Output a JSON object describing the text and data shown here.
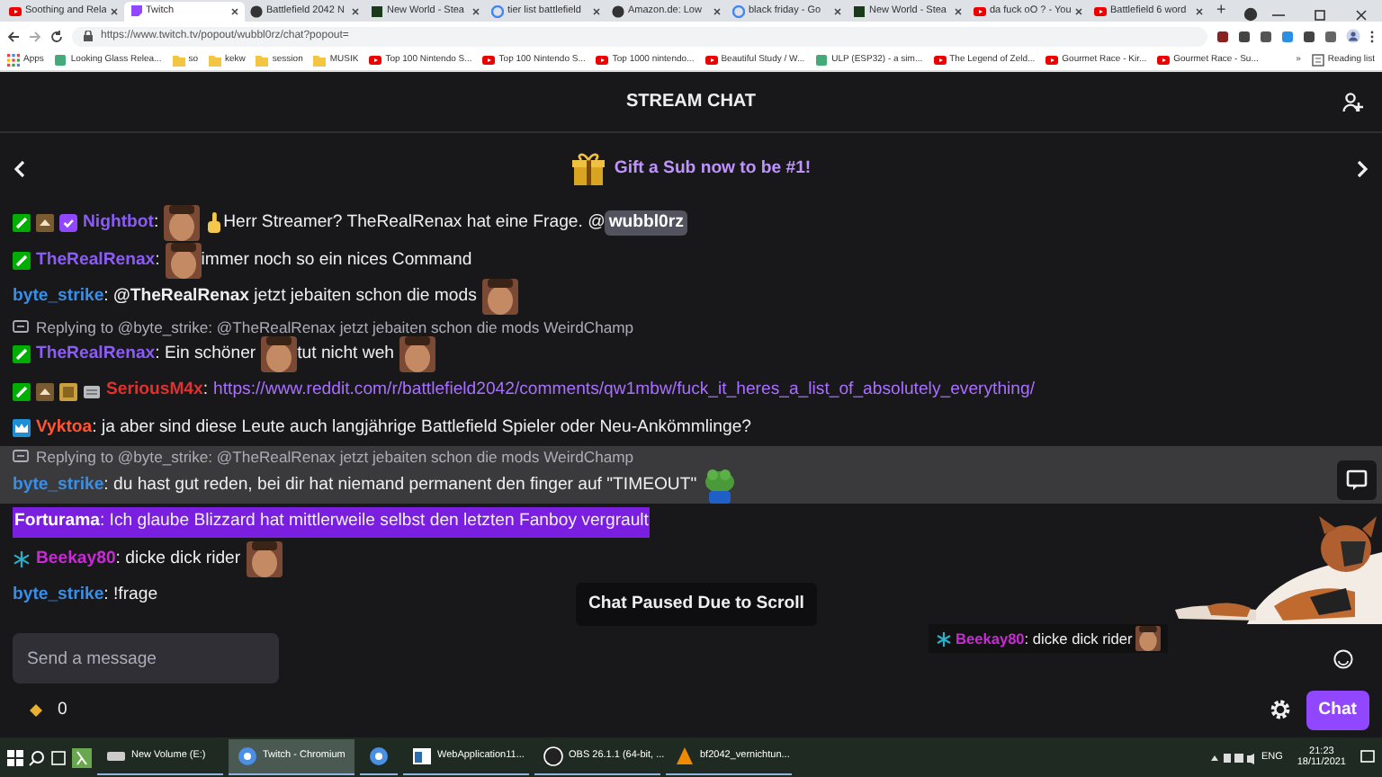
{
  "browser": {
    "tabs": [
      {
        "title": "Soothing and Rela",
        "selected": false
      },
      {
        "title": "Twitch",
        "selected": true
      },
      {
        "title": "Battlefield 2042 N",
        "selected": false
      },
      {
        "title": "New World - Stea",
        "selected": false
      },
      {
        "title": "tier list battlefield",
        "selected": false
      },
      {
        "title": "Amazon.de: Low",
        "selected": false
      },
      {
        "title": "black friday - Go",
        "selected": false
      },
      {
        "title": "New World - Stea",
        "selected": false
      },
      {
        "title": "da fuck oO ? - You",
        "selected": false
      },
      {
        "title": "Battlefield 6 word",
        "selected": false
      }
    ],
    "new_tab": "+",
    "url": "https://www.twitch.tv/popout/wubbl0rz/chat?popout=",
    "bookmarks": [
      "Apps",
      "Looking Glass Relea...",
      "so",
      "kekw",
      "session",
      "MUSIK",
      "Top 100 Nintendo S...",
      "Top 100 Nintendo S...",
      "Top 1000 nintendo...",
      "Beautiful Study / W...",
      "ULP (ESP32) - a sim...",
      "The Legend of Zeld...",
      "Gourmet Race - Kir...",
      "Gourmet Race - Su..."
    ],
    "more": "»",
    "reading_list": "Reading list"
  },
  "chat": {
    "title": "STREAM CHAT",
    "banner": "Gift a Sub now to be #1!",
    "messages": [
      {
        "user": "Nightbot",
        "color": "#8c5cf6",
        "badges": [
          {
            "kind": "moderator"
          },
          {
            "kind": "sub"
          },
          {
            "kind": "verified"
          }
        ],
        "highlighted": false,
        "hovered": false,
        "segments": [
          {
            "kind": "text",
            "text": ":"
          },
          {
            "kind": "emote"
          },
          {
            "kind": "emoji"
          },
          {
            "kind": "text",
            "text": "Herr Streamer? TheRealRenax hat eine Frage. @"
          },
          {
            "kind": "mention",
            "text": "wubbl0rz"
          }
        ]
      },
      {
        "user": "TheRealRenax",
        "color": "#8c5cf6",
        "badges": [
          {
            "kind": "moderator"
          }
        ],
        "highlighted": false,
        "hovered": false,
        "segments": [
          {
            "kind": "text",
            "text": ":"
          },
          {
            "kind": "emote"
          },
          {
            "kind": "text",
            "text": "immer noch so ein nices Command"
          }
        ]
      },
      {
        "user": "byte_strike",
        "color": "#3a8ee6",
        "highlighted": false,
        "hovered": false,
        "segments": [
          {
            "kind": "text",
            "text": ": **@TheRealRenax** jetzt jebaiten schon die mods"
          },
          {
            "kind": "emote"
          }
        ]
      },
      {
        "reply_to": "Replying to @byte_strike: @TheRealRenax jetzt jebaiten schon die mods WeirdChamp",
        "user": "TheRealRenax",
        "color": "#8c5cf6",
        "badges": [
          {
            "kind": "moderator"
          }
        ],
        "highlighted": false,
        "hovered": false,
        "segments": [
          {
            "kind": "text",
            "text": ": Ein schöner"
          },
          {
            "kind": "emote"
          },
          {
            "kind": "text",
            "text": "tut nicht weh"
          },
          {
            "kind": "emote"
          }
        ]
      },
      {
        "user": "SeriousM4x",
        "color": "#e0312f",
        "badges": [
          {
            "kind": "moderator"
          },
          {
            "kind": "sub"
          },
          {
            "kind": "gift"
          },
          {
            "kind": "bits"
          }
        ],
        "highlighted": false,
        "hovered": false,
        "segments": [
          {
            "kind": "text",
            "text": ":"
          },
          {
            "kind": "link",
            "text": "https://www.reddit.com/r/battlefield2042/comments/qw1mbw/fuck_it_heres_a_list_of_absolutely_everything/"
          }
        ]
      },
      {
        "user": "Vyktoa",
        "color": "#ff5533",
        "badges": [
          {
            "kind": "crown"
          }
        ],
        "highlighted": false,
        "hovered": false,
        "segments": [
          {
            "kind": "text",
            "text": ": ja aber sind diese Leute auch langjährige Battlefield Spieler oder Neu-Ankömmlinge?"
          }
        ]
      },
      {
        "reply_to": "Replying to @byte_strike: @TheRealRenax jetzt jebaiten schon die mods WeirdChamp",
        "user": "byte_strike",
        "color": "#3a8ee6",
        "highlighted": false,
        "hovered": true,
        "segments": [
          {
            "kind": "text",
            "text": ": du hast gut reden, bei dir hat niemand permanent den finger auf \"TIMEOUT\""
          },
          {
            "kind": "frog"
          }
        ]
      },
      {
        "user": "Forturama",
        "color": "#ffffff",
        "highlighted": true,
        "hovered": false,
        "segments": [
          {
            "kind": "text",
            "text": ": Ich glaube Blizzard hat mittlerweile selbst den letzten Fanboy vergrault"
          }
        ]
      },
      {
        "user": "Beekay80",
        "color": "#c82ad6",
        "badges": [
          {
            "kind": "snowflake"
          }
        ],
        "highlighted": false,
        "hovered": false,
        "segments": [
          {
            "kind": "text",
            "text": ": dicke dick rider"
          },
          {
            "kind": "emote"
          }
        ]
      },
      {
        "user": "byte_strike",
        "color": "#3a8ee6",
        "highlighted": false,
        "hovered": false,
        "segments": [
          {
            "kind": "text",
            "text": ": !frage"
          }
        ]
      }
    ],
    "paused_notice": "Chat Paused Due to Scroll",
    "overlay_message": {
      "user": "Beekay80",
      "color": "#c82ad6",
      "text": ": dicke dick rider"
    },
    "input": {
      "placeholder": "Send a message"
    },
    "points": "0",
    "send_button": "Chat"
  },
  "taskbar": {
    "items": [
      {
        "title": "New Volume (E:)",
        "selected": false
      },
      {
        "title": "Twitch - Chromium",
        "selected": true
      },
      {
        "selected": false
      },
      {
        "title": "WebApplication11...",
        "selected": false
      },
      {
        "title": "OBS 26.1.1 (64-bit, ...",
        "selected": false
      },
      {
        "title": "bf2042_vernichtun...",
        "selected": false
      }
    ],
    "language": "ENG",
    "time": "21:23",
    "date": "18/11/2021"
  }
}
